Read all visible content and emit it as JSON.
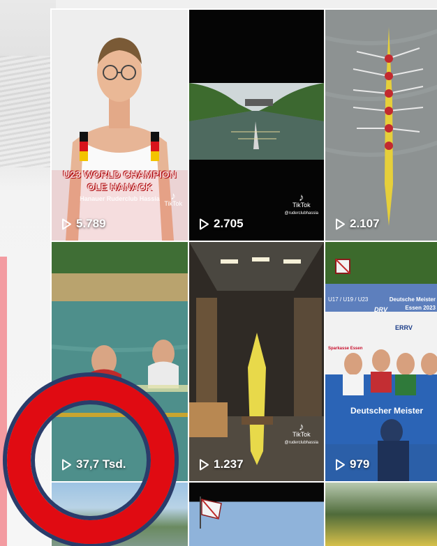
{
  "tiles": [
    {
      "views": "5.789",
      "overlay_line1": "U23 WORLD CHAMPION",
      "overlay_line2": "OLE HANACK",
      "overlay_line3": "Hanauer Ruderclub Hassia",
      "tiktok": "TikTok"
    },
    {
      "views": "2.705",
      "tiktok": "TikTok",
      "handle": "@ruderclubhassia"
    },
    {
      "views": "2.107"
    },
    {
      "views": "37,7 Tsd."
    },
    {
      "views": "1.237",
      "tiktok": "TikTok",
      "handle": "@ruderclubhassia"
    },
    {
      "views": "979",
      "banner_top": "Deutsche Meister",
      "banner_year": "Essen 2023",
      "banner_left": "U17 / U19 / U23",
      "banner_drv": "DRV",
      "banner_errv": "ERRV",
      "banner_sponsor": "Sparkasse Essen",
      "banner_bottom": "Deutscher Meister"
    },
    {
      "views": ""
    },
    {
      "views": ""
    },
    {
      "views": ""
    }
  ],
  "colors": {
    "highlight_ring": "#e00b12",
    "ring_outline": "#2a3c6a",
    "accent_bar": "#f39ba1"
  },
  "icons": {
    "play": "play-outline-icon",
    "tiktok": "tiktok-logo-icon"
  }
}
